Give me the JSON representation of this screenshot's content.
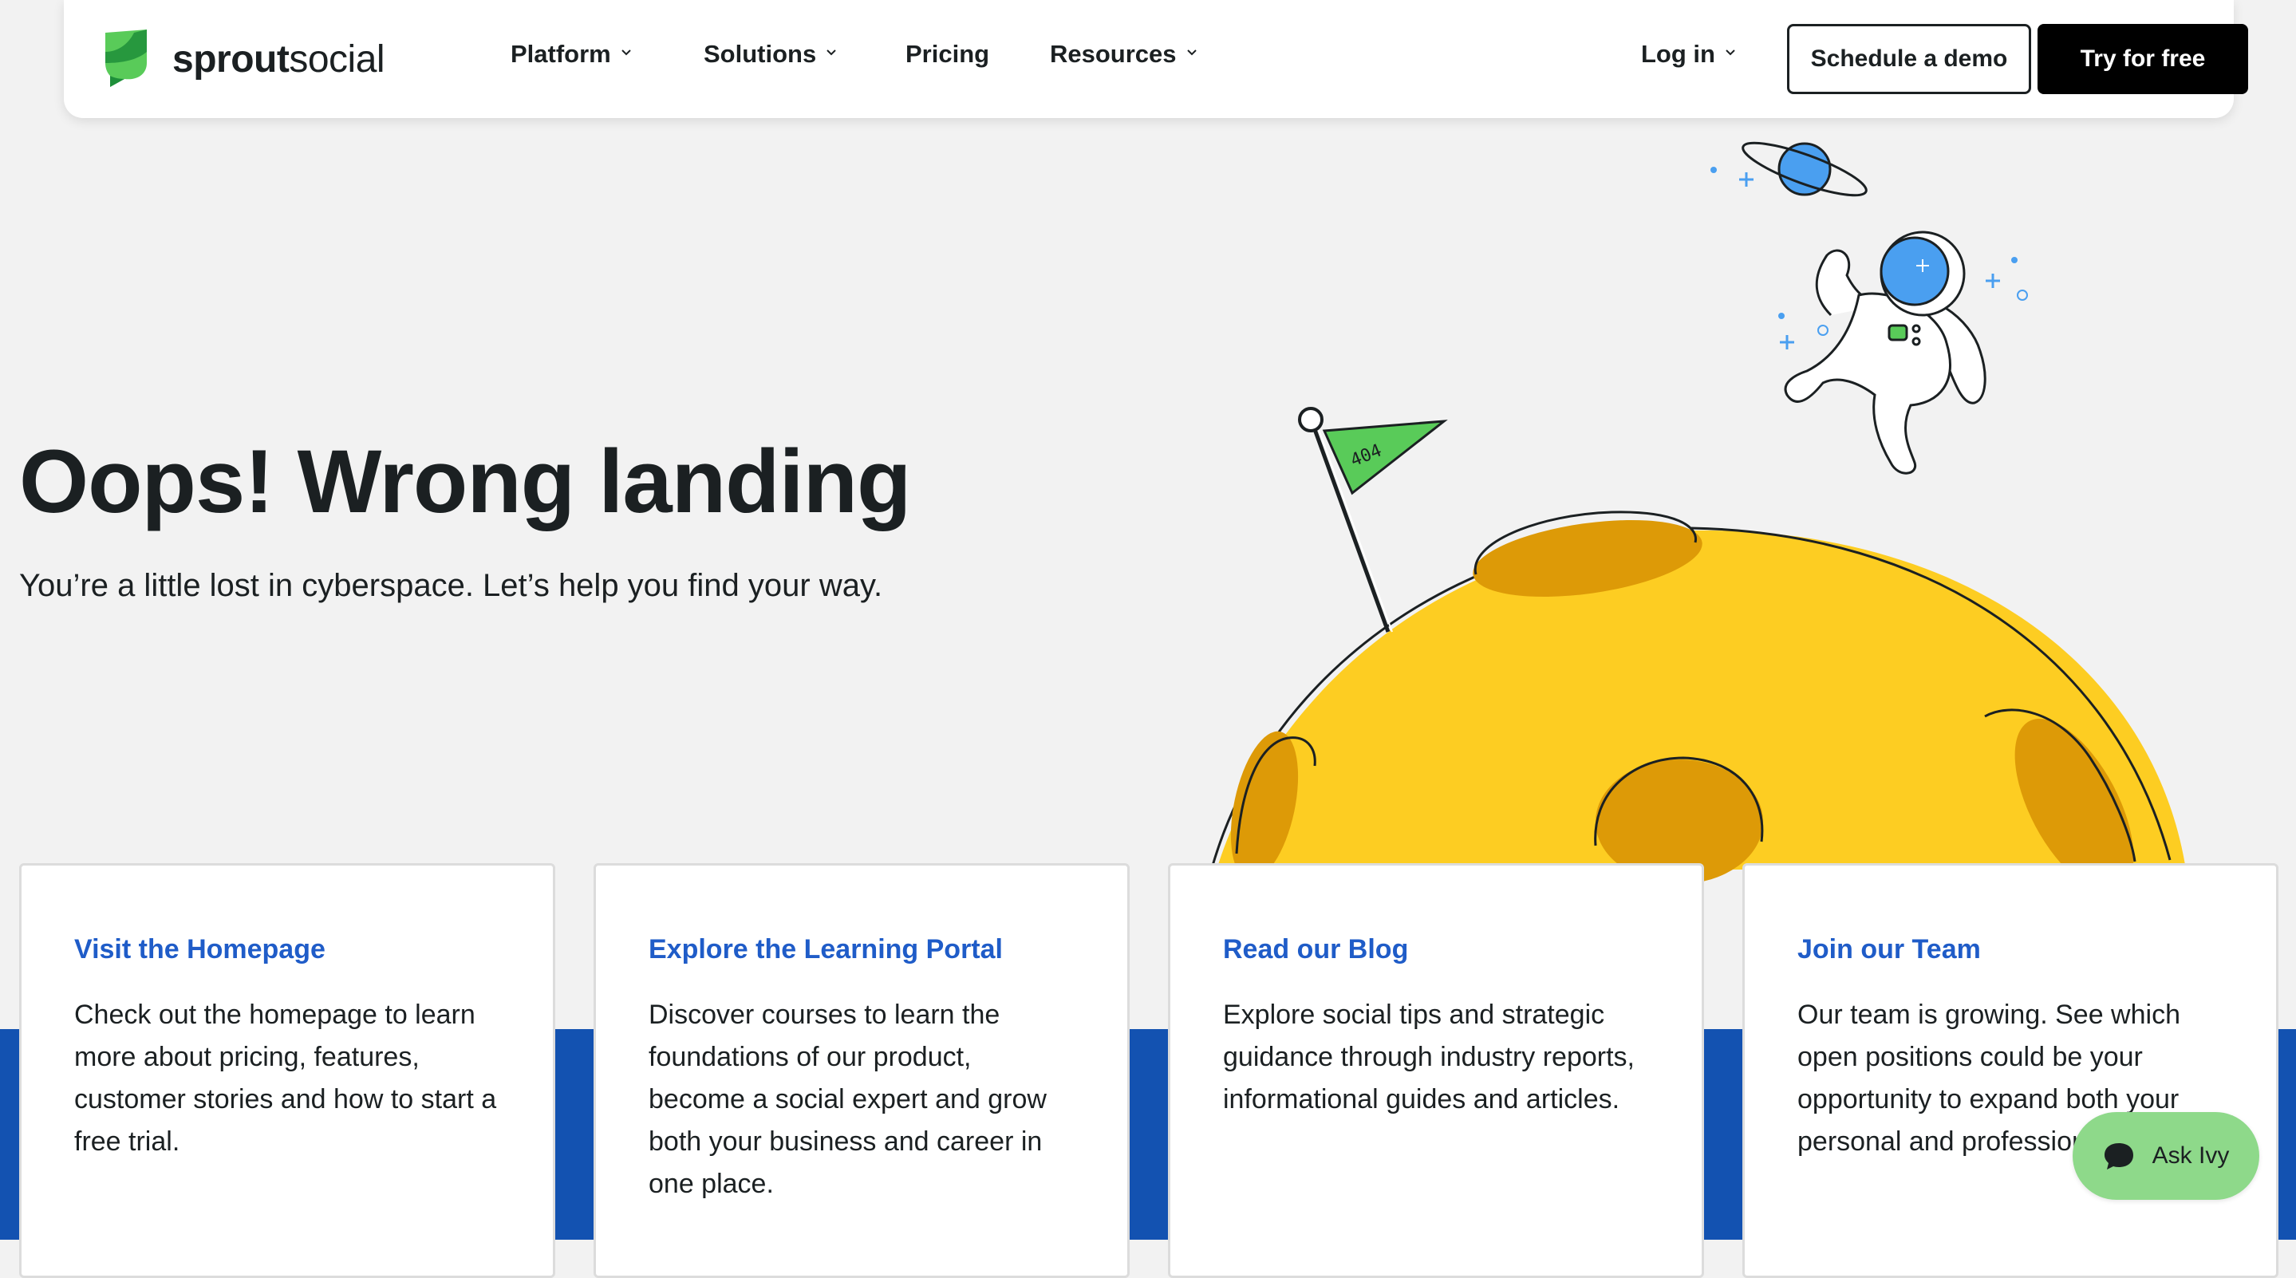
{
  "header": {
    "logo": {
      "text_bold": "sprout",
      "text_light": "social",
      "icon": "sprout-leaf-icon"
    },
    "nav": [
      {
        "label": "Platform",
        "has_dropdown": true
      },
      {
        "label": "Solutions",
        "has_dropdown": true
      },
      {
        "label": "Pricing",
        "has_dropdown": false
      },
      {
        "label": "Resources",
        "has_dropdown": true
      }
    ],
    "login_label": "Log in",
    "demo_label": "Schedule a demo",
    "try_label": "Try for free"
  },
  "hero": {
    "title": "Oops! Wrong landing",
    "subtitle": "You’re a little lost in cyberspace. Let’s help you find your way.",
    "flag_text": "404"
  },
  "cards": [
    {
      "title": "Visit the Homepage",
      "body": "Check out the homepage to learn more about pricing, features, customer stories and how to start a free trial."
    },
    {
      "title": "Explore the Learning Portal",
      "body": "Discover courses to learn the foundations of our product, become a social expert and grow both your business and career in one place."
    },
    {
      "title": "Read our Blog",
      "body": "Explore social tips and strategic guidance through industry reports, informational guides and articles."
    },
    {
      "title": "Join our Team",
      "body": "Our team is growing. See which open positions could be your opportunity to expand both your personal and professional"
    }
  ],
  "chat": {
    "label": "Ask Ivy",
    "icon": "chat-bubble-icon"
  },
  "colors": {
    "brand_green": "#59cb59",
    "moon_yellow": "#fdcd22",
    "crater": "#dd9a07",
    "band_blue": "#1352b1",
    "link_blue": "#1f5cc8",
    "chat_green": "#8ed98a",
    "page_bg": "#f2f2f2"
  }
}
